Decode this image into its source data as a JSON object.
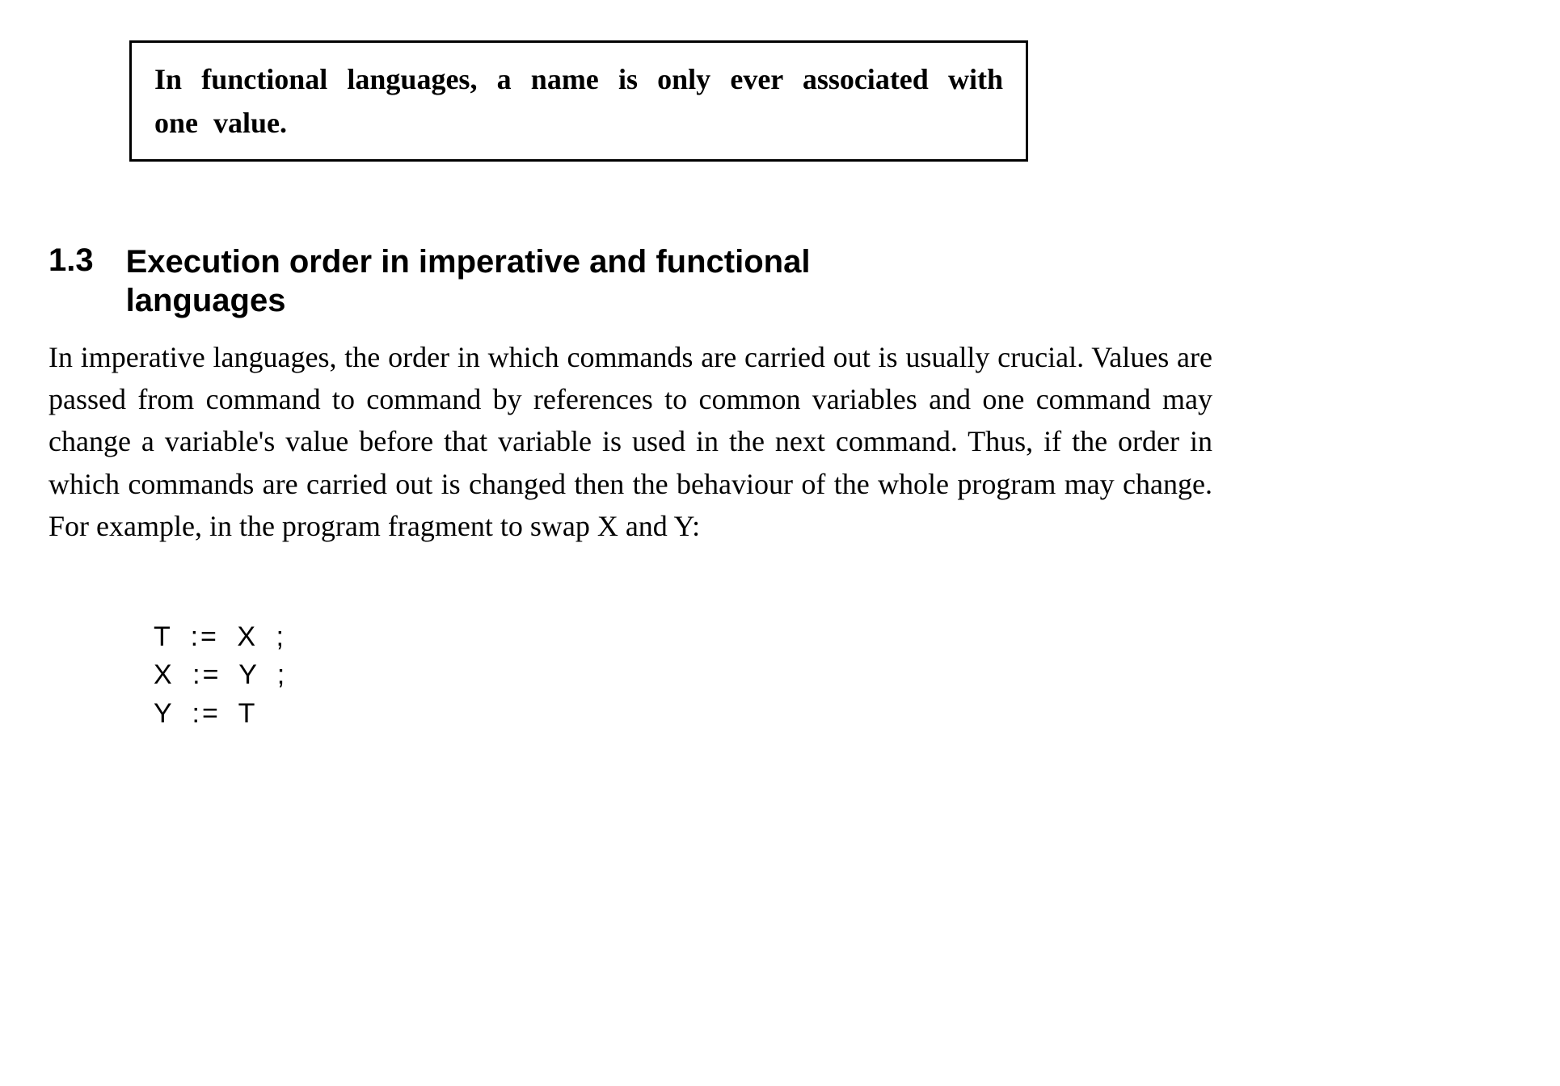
{
  "callout": {
    "text": "In functional languages, a name is only ever associated with one value."
  },
  "section": {
    "number": "1.3",
    "title": "Execution order in imperative and functional languages"
  },
  "paragraph": "In imperative languages, the order in which commands are carried out is usually crucial. Values are passed from command to command by references to common variables and one command may change a variable's value before that variable is used in the next command. Thus, if the order in which commands are carried out is changed then the behaviour of the whole program may change. For example, in the program fragment to swap X and Y:",
  "code": {
    "line1": "T := X ;",
    "line2": "X := Y ;",
    "line3": "Y := T"
  }
}
